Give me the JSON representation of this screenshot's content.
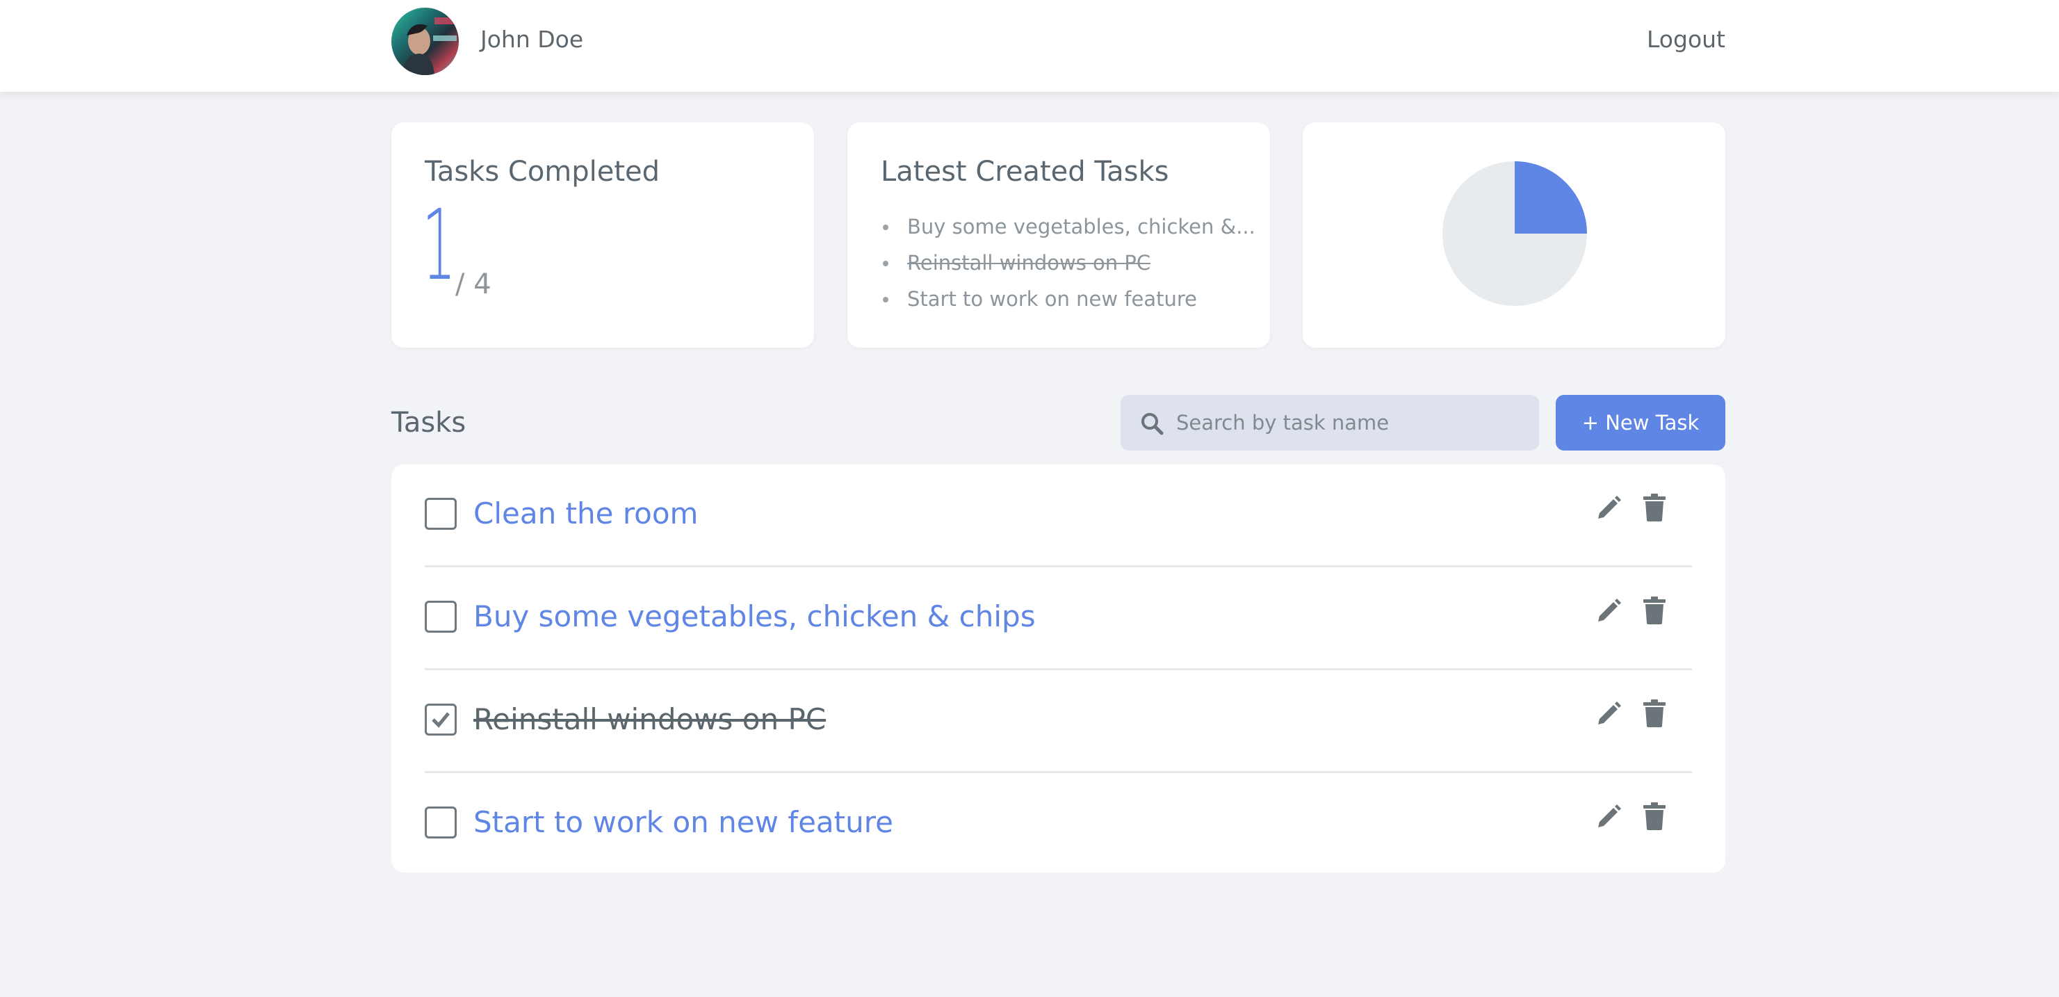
{
  "header": {
    "username": "John Doe",
    "logout_label": "Logout"
  },
  "stats": {
    "completed_title": "Tasks Completed",
    "completed_count": "1",
    "total_label": "/ 4",
    "completed_fraction": 0.25
  },
  "latest": {
    "title": "Latest Created Tasks",
    "items": [
      {
        "label": "Buy some vegetables, chicken &...",
        "done": false
      },
      {
        "label": "Reinstall windows on PC",
        "done": true
      },
      {
        "label": "Start to work on new feature",
        "done": false
      }
    ]
  },
  "tasks_section": {
    "title": "Tasks",
    "search_placeholder": "Search by task name",
    "new_task_label": "+ New Task"
  },
  "tasks": [
    {
      "name": "Clean the room",
      "done": false
    },
    {
      "name": "Buy some vegetables, chicken & chips",
      "done": false
    },
    {
      "name": "Reinstall windows on PC",
      "done": true
    },
    {
      "name": "Start to work on new feature",
      "done": false
    }
  ],
  "colors": {
    "accent": "#5f85e5",
    "background": "#f2f3f6",
    "card": "#ffffff",
    "muted_text": "#5b6770",
    "pie_rest": "#e8ebee",
    "search_bg": "#dee2ec"
  },
  "icons": {
    "search": "search-icon",
    "edit": "pencil-icon",
    "delete": "trash-icon",
    "check": "check-icon"
  }
}
